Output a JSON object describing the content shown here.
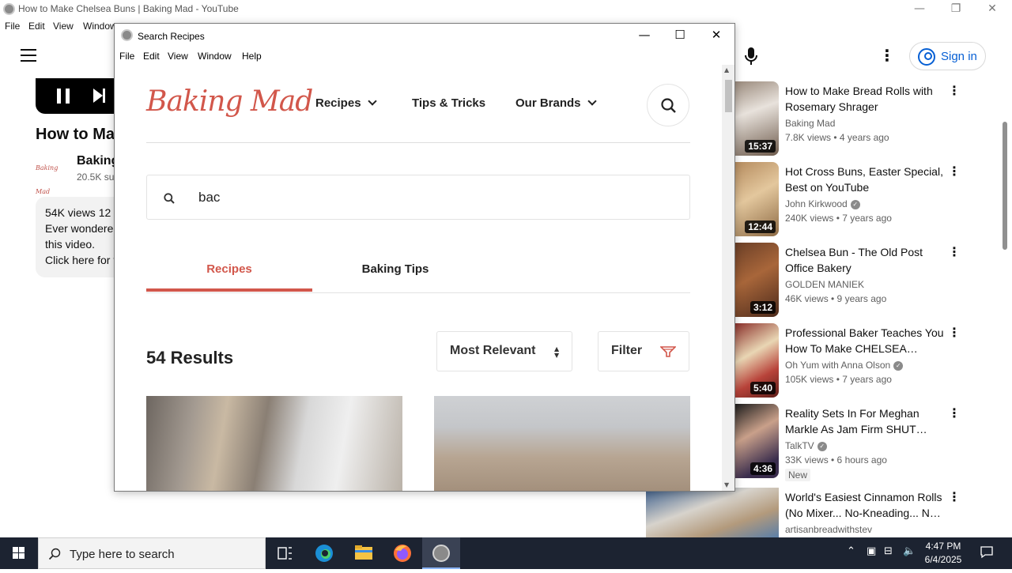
{
  "youtube": {
    "window_title": "How to Make Chelsea Buns | Baking Mad - YouTube",
    "menu": [
      "File",
      "Edit",
      "View",
      "Window"
    ],
    "video_title": "How to Mal",
    "channel_logo_text": "Baking Mad",
    "channel_name": "Baking",
    "subscribers": "20.5K su",
    "description_lines": [
      "54K views  12",
      "Ever wondered",
      "this video.",
      "Click here for t"
    ],
    "sign_in_label": "Sign in",
    "recommendations": [
      {
        "title": "How to Make Bread Rolls with Rosemary Shrager",
        "channel": "Baking Mad",
        "verified": false,
        "meta": "7.8K views  • 4 years ago",
        "duration": "15:37",
        "new": ""
      },
      {
        "title": "Hot Cross Buns, Easter Special, Best on YouTube",
        "channel": "John Kirkwood",
        "verified": true,
        "meta": "240K views  • 7 years ago",
        "duration": "12:44",
        "new": ""
      },
      {
        "title": "Chelsea Bun - The Old Post Office Bakery",
        "channel": "GOLDEN MANIEK",
        "verified": false,
        "meta": "46K views  • 9 years ago",
        "duration": "3:12",
        "new": ""
      },
      {
        "title": "Professional Baker Teaches You How To Make CHELSEA…",
        "channel": "Oh Yum with Anna Olson",
        "verified": true,
        "meta": "105K views  • 7 years ago",
        "duration": "5:40",
        "new": ""
      },
      {
        "title": "Reality Sets In For Meghan Markle As Jam Firm SHUT…",
        "channel": "TalkTV",
        "verified": true,
        "meta": "33K views  • 6 hours ago",
        "duration": "4:36",
        "new": "New"
      },
      {
        "title": "World's Easiest Cinnamon Rolls (No Mixer... No-Kneading... N…",
        "channel": "artisanbreadwithstev",
        "verified": false,
        "meta": "",
        "duration": "",
        "new": ""
      }
    ]
  },
  "recipes_window": {
    "title": "Search Recipes",
    "menu": [
      "File",
      "Edit",
      "View",
      "Window",
      "Help"
    ],
    "logo_text": "Baking Mad",
    "nav": {
      "recipes": "Recipes",
      "tips": "Tips & Tricks",
      "brands": "Our Brands"
    },
    "search_value": "bac",
    "tabs": {
      "recipes": "Recipes",
      "baking_tips": "Baking Tips"
    },
    "results_count": "54 Results",
    "sort_label": "Most Relevant",
    "filter_label": "Filter"
  },
  "taskbar": {
    "search_placeholder": "Type here to search",
    "time": "4:47 PM",
    "date": "6/4/2025"
  },
  "colors": {
    "brand": "#d2574b",
    "yt_blue": "#065fd4",
    "taskbar": "#1c2331"
  }
}
